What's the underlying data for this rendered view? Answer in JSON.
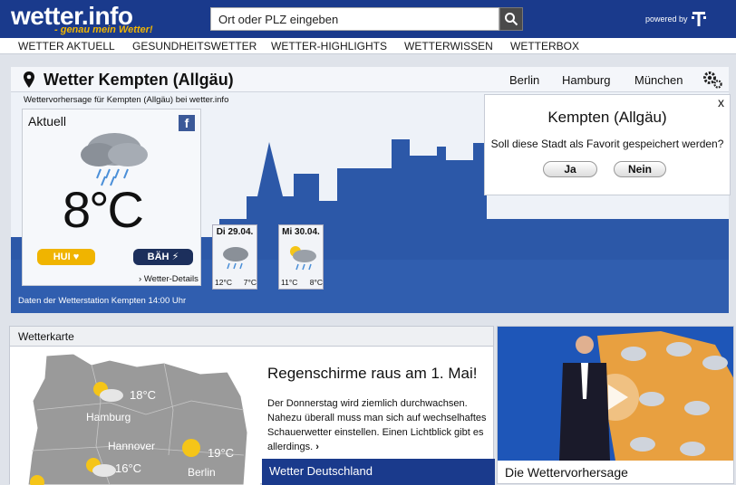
{
  "header": {
    "logo": "wetter.info",
    "tagline": "- genau mein Wetter!",
    "search_placeholder": "Ort oder PLZ eingeben",
    "powered_by": "powered by"
  },
  "nav": [
    "WETTER AKTUELL",
    "GESUNDHEITSWETTER",
    "WETTER-HIGHLIGHTS",
    "WETTERWISSEN",
    "WETTERBOX"
  ],
  "location": {
    "title": "Wetter Kempten (Allgäu)",
    "cities": [
      "Berlin",
      "Hamburg",
      "München"
    ],
    "subline": "Wettervorhersage für Kempten (Allgäu) bei wetter.info"
  },
  "current": {
    "label": "Aktuell",
    "temperature": "8°C",
    "hui": "HUI",
    "baeh": "BÄH",
    "details_link": "Wetter-Details",
    "station": "Daten der Wetterstation Kempten 14:00 Uhr"
  },
  "forecast": [
    {
      "date": "Di 29.04.",
      "max": "12°C",
      "min": "7°C",
      "icon": "cloud-rain-icon"
    },
    {
      "date": "Mi 30.04.",
      "max": "11°C",
      "min": "8°C",
      "icon": "sun-cloud-rain-icon"
    }
  ],
  "popup": {
    "close": "x",
    "title": "Kempten (Allgäu)",
    "question": "Soll diese Stadt als Favorit gespeichert werden?",
    "yes": "Ja",
    "no": "Nein"
  },
  "wetterkarte": {
    "title": "Wetterkarte",
    "map_labels": [
      {
        "city": "Hamburg",
        "temp": "18°C"
      },
      {
        "city": "Berlin",
        "temp": "19°C"
      },
      {
        "city": "Hannover",
        "temp": "16°C"
      }
    ],
    "headline": "Regenschirme raus am 1. Mai!",
    "article": "Der Donnerstag wird ziemlich durchwachsen. Nahezu überall muss man sich auf wechselhaftes Schauerwetter einstellen. Einen Lichtblick gibt es allerdings.",
    "deutschland": "Wetter Deutschland"
  },
  "video": {
    "caption": "Die Wettervorhersage"
  },
  "colors": {
    "brand_blue": "#1a3a8c",
    "accent_yellow": "#f0b400",
    "telekom_magenta": "#e20074"
  }
}
